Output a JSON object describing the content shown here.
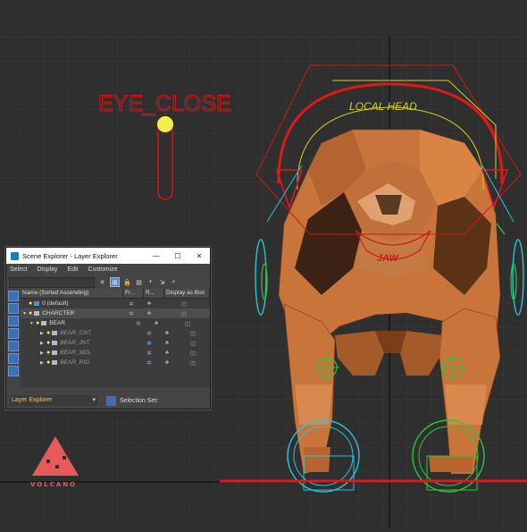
{
  "viewport": {
    "labels": {
      "eye_close": "EYE_CLOSE",
      "local_head": "LOCAL HEAD",
      "jaw": "JAW"
    }
  },
  "scene_explorer": {
    "title": "Scene Explorer - Layer Explorer",
    "window_buttons": {
      "minimize": "—",
      "maximize": "☐",
      "close": "✕"
    },
    "menu": [
      "Select",
      "Display",
      "Edit",
      "Customize"
    ],
    "columns": [
      "Name (Sorted Ascending)",
      "Fr...",
      "R...",
      "Display as Box"
    ],
    "rows": [
      {
        "name": "0 (default)"
      },
      {
        "name": "CHARCTER"
      },
      {
        "name": "BEAR"
      },
      {
        "name": "BEAR_CNT"
      },
      {
        "name": "BEAR_JNT"
      },
      {
        "name": "BEAR_MDL"
      },
      {
        "name": "BEAR_RIG"
      }
    ],
    "footer": {
      "explorer": "Layer Explorer",
      "selection_set": "Selection Set:"
    }
  },
  "logo": {
    "text": "VOLCANO",
    "color": "#e85a5a"
  },
  "colors": {
    "rig_red": "#e01818",
    "rig_yellow": "#d8d020",
    "rig_cyan": "#26c6d8",
    "rig_green": "#2ac83a",
    "bear_orange": "#c8743a"
  }
}
